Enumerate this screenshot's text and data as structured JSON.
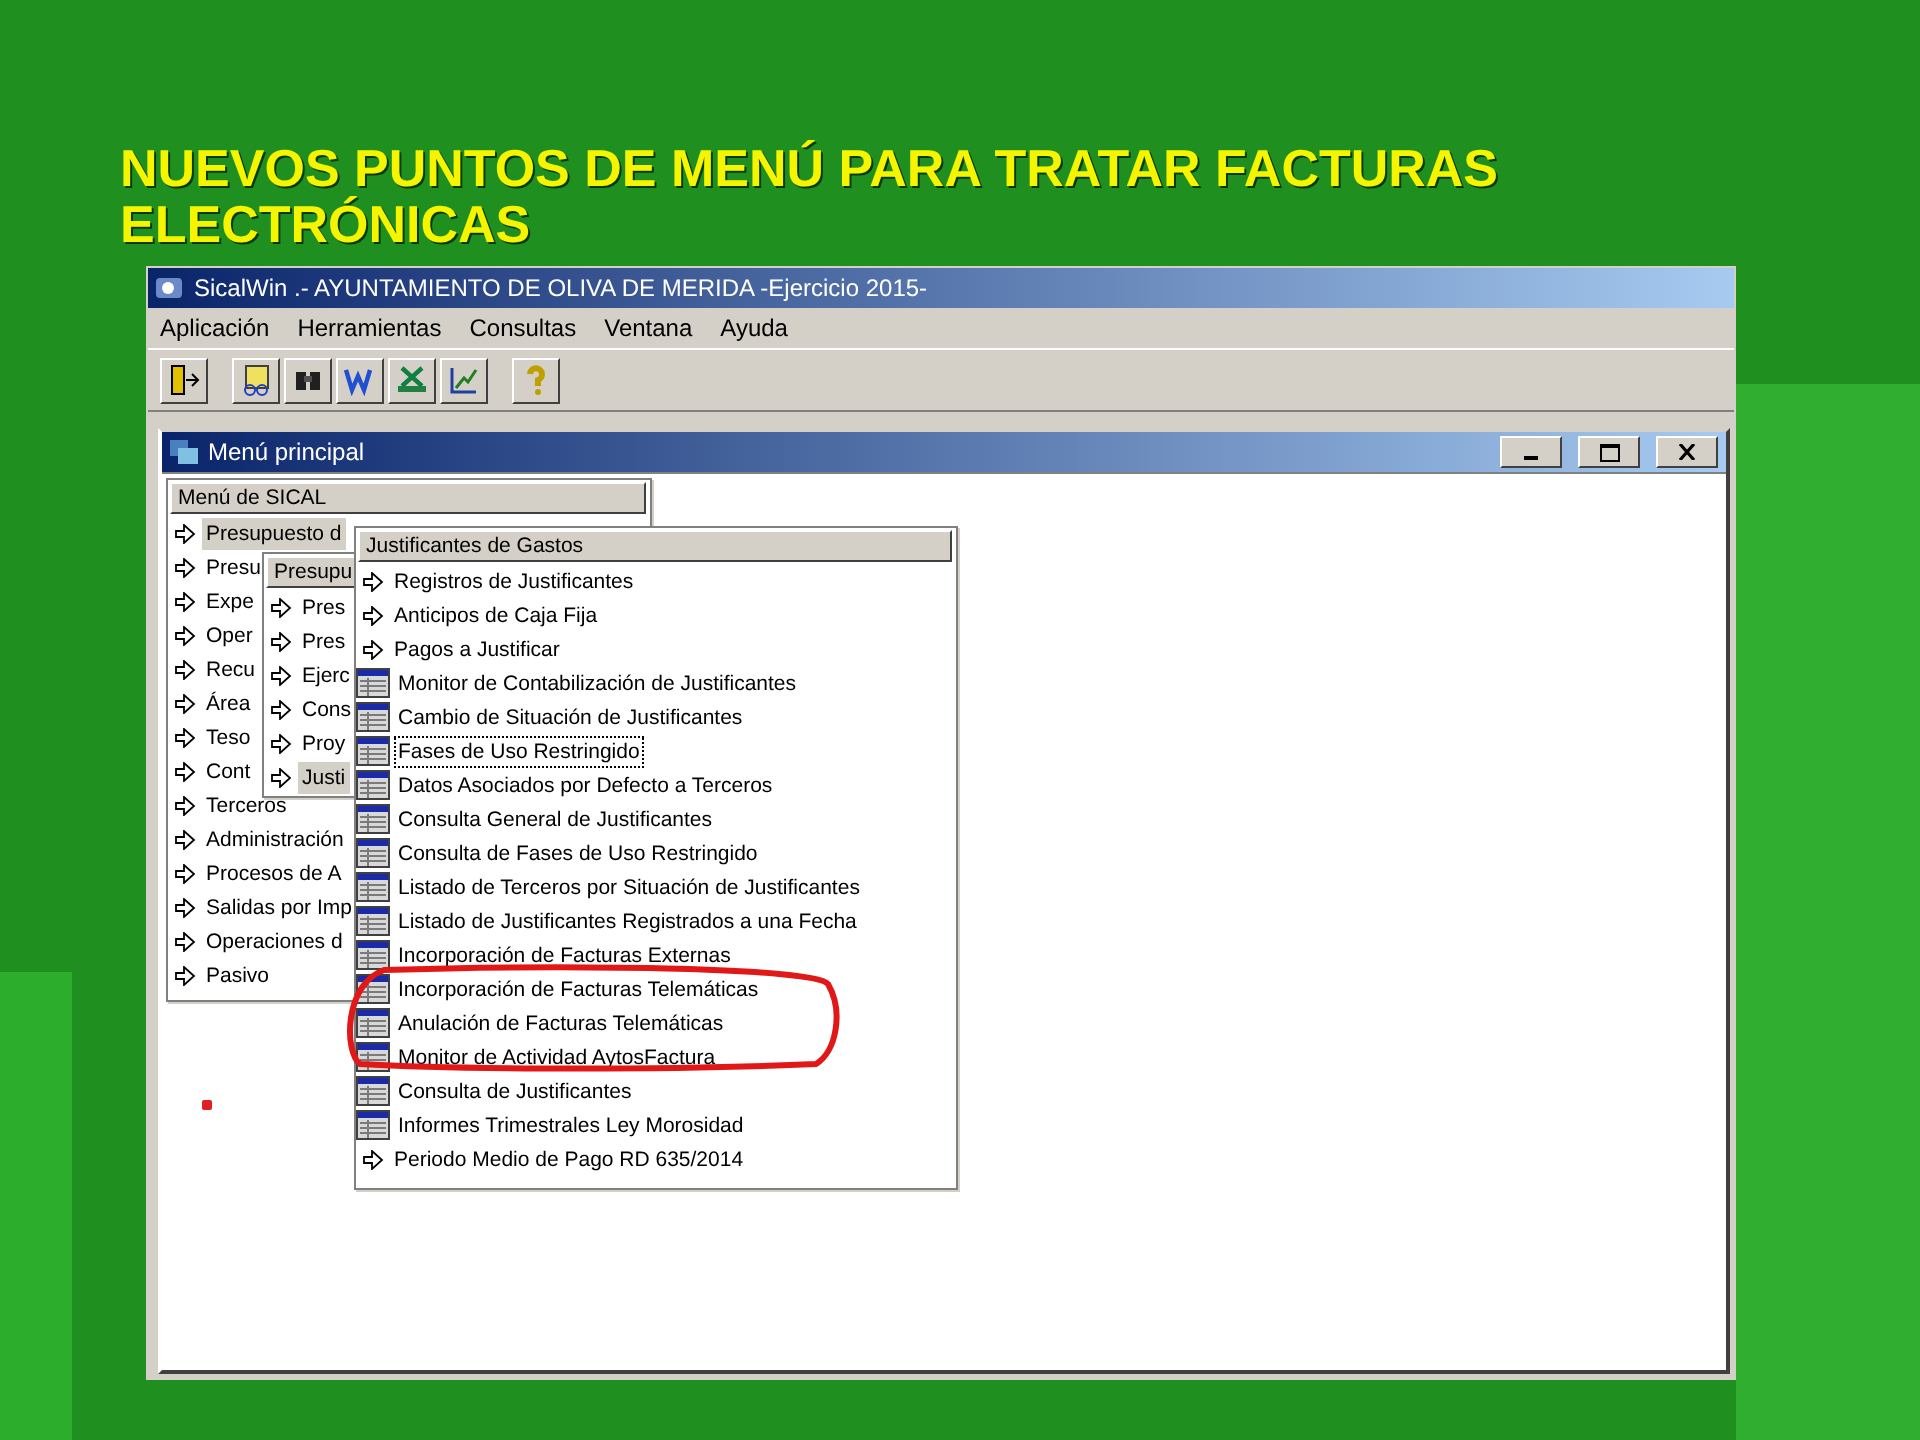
{
  "slide_title": "NUEVOS PUNTOS DE MENÚ PARA TRATAR FACTURAS ELECTRÓNICAS",
  "window": {
    "title": "SicalWin .- AYUNTAMIENTO DE OLIVA DE MERIDA -Ejercicio 2015-"
  },
  "menu_bar": [
    "Aplicación",
    "Herramientas",
    "Consultas",
    "Ventana",
    "Ayuda"
  ],
  "child_window": {
    "title": "Menú principal"
  },
  "menus": [
    {
      "header": "Menú de SICAL",
      "items": [
        {
          "label": "Presupuesto d",
          "kind": "arrow",
          "selected": true
        },
        {
          "label": "Presu",
          "kind": "arrow",
          "selected": false
        },
        {
          "label": "Expe",
          "kind": "arrow",
          "selected": false
        },
        {
          "label": "Oper",
          "kind": "arrow",
          "selected": false
        },
        {
          "label": "Recu",
          "kind": "arrow",
          "selected": false
        },
        {
          "label": "Área",
          "kind": "arrow",
          "selected": false
        },
        {
          "label": "Teso",
          "kind": "arrow",
          "selected": false
        },
        {
          "label": "Cont",
          "kind": "arrow",
          "selected": false
        },
        {
          "label": "Terceros",
          "kind": "arrow",
          "selected": false
        },
        {
          "label": "Administración",
          "kind": "arrow",
          "selected": false
        },
        {
          "label": "Procesos de A",
          "kind": "arrow",
          "selected": false
        },
        {
          "label": "Salidas por Imp",
          "kind": "arrow",
          "selected": false
        },
        {
          "label": "Operaciones d",
          "kind": "arrow",
          "selected": false
        },
        {
          "label": "Pasivo",
          "kind": "arrow",
          "selected": false
        }
      ]
    },
    {
      "header": "Presupu",
      "items": [
        {
          "label": "Pres",
          "kind": "arrow",
          "selected": false
        },
        {
          "label": "Pres",
          "kind": "arrow",
          "selected": false
        },
        {
          "label": "Ejerc",
          "kind": "arrow",
          "selected": false
        },
        {
          "label": "Cons",
          "kind": "arrow",
          "selected": false
        },
        {
          "label": "Proy",
          "kind": "arrow",
          "selected": false
        },
        {
          "label": "Justi",
          "kind": "arrow",
          "selected": true
        }
      ]
    },
    {
      "header": "Justificantes de Gastos",
      "items": [
        {
          "label": "Registros de Justificantes",
          "kind": "arrow",
          "selected": false
        },
        {
          "label": "Anticipos de Caja Fija",
          "kind": "arrow",
          "selected": false
        },
        {
          "label": "Pagos a Justificar",
          "kind": "arrow",
          "selected": false
        },
        {
          "label": "Monitor de Contabilización de Justificantes",
          "kind": "table",
          "selected": false
        },
        {
          "label": "Cambio de Situación de Justificantes",
          "kind": "table",
          "selected": false
        },
        {
          "label": "Fases de Uso Restringido",
          "kind": "table",
          "selected": true
        },
        {
          "label": "Datos Asociados por Defecto a Terceros",
          "kind": "table",
          "selected": false
        },
        {
          "label": "Consulta General de Justificantes",
          "kind": "table",
          "selected": false
        },
        {
          "label": "Consulta de Fases de Uso Restringido",
          "kind": "table",
          "selected": false
        },
        {
          "label": "Listado de Terceros por Situación de Justificantes",
          "kind": "table",
          "selected": false
        },
        {
          "label": "Listado de Justificantes Registrados a una Fecha",
          "kind": "table",
          "selected": false
        },
        {
          "label": "Incorporación de Facturas Externas",
          "kind": "table",
          "selected": false
        },
        {
          "label": "Incorporación de Facturas Telemáticas",
          "kind": "table",
          "selected": false
        },
        {
          "label": "Anulación de Facturas Telemáticas",
          "kind": "table",
          "selected": false
        },
        {
          "label": "Monitor de Actividad AytosFactura",
          "kind": "table",
          "selected": false
        },
        {
          "label": "Consulta de Justificantes",
          "kind": "table",
          "selected": false
        },
        {
          "label": "Informes Trimestrales Ley Morosidad",
          "kind": "table",
          "selected": false
        },
        {
          "label": "Periodo Medio de Pago RD 635/2014",
          "kind": "arrow",
          "selected": false
        }
      ]
    }
  ]
}
